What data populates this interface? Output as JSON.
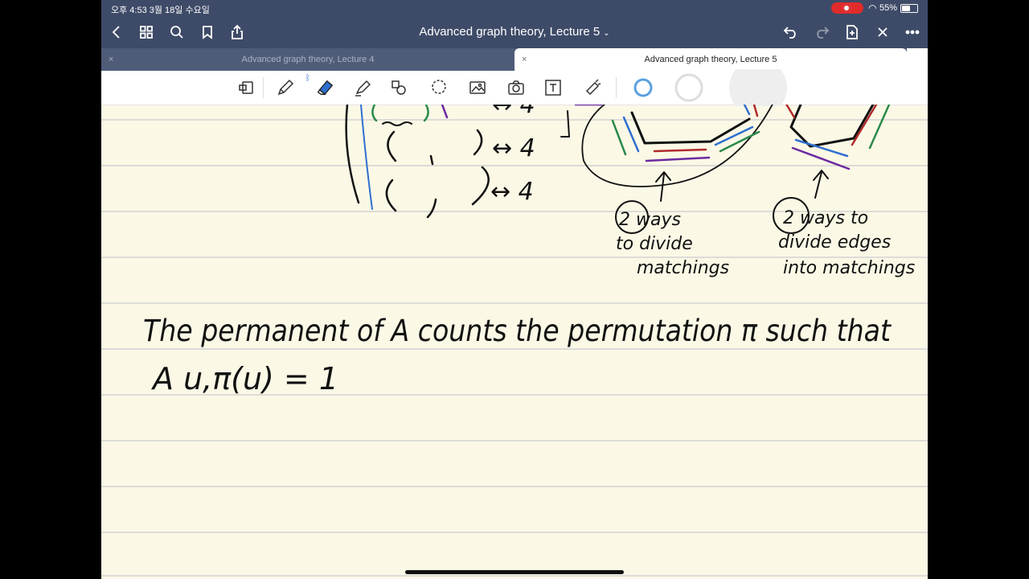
{
  "status": {
    "time": "오후 4:53   3월 18일 수요일",
    "battery": "55%"
  },
  "nav": {
    "title": "Advanced graph theory, Lecture 5"
  },
  "tabs": [
    {
      "label": "Advanced graph theory, Lecture 4",
      "active": false
    },
    {
      "label": "Advanced graph theory, Lecture 5",
      "active": true
    }
  ],
  "notes": {
    "arrow_labels": [
      "↔ 4",
      "↔ 4",
      "↔ 4"
    ],
    "annotation_left": [
      "2 ways",
      "to divide",
      "matchings"
    ],
    "annotation_right": [
      "2 ways to",
      "divide edges",
      "into matchings"
    ],
    "line1": "The permanent of A counts the permutation π such that",
    "line2": "A u,π(u) = 1"
  },
  "colors": {
    "bar": "#3e4b68",
    "paper": "#fbf8e6",
    "ruled_line": "#c9cbd0",
    "ink": "#111111",
    "blue": "#2f6fd0",
    "red": "#b02a2a",
    "green": "#2a8a4a",
    "purple": "#6b2aa0",
    "highlight": "#5aa0e0"
  }
}
